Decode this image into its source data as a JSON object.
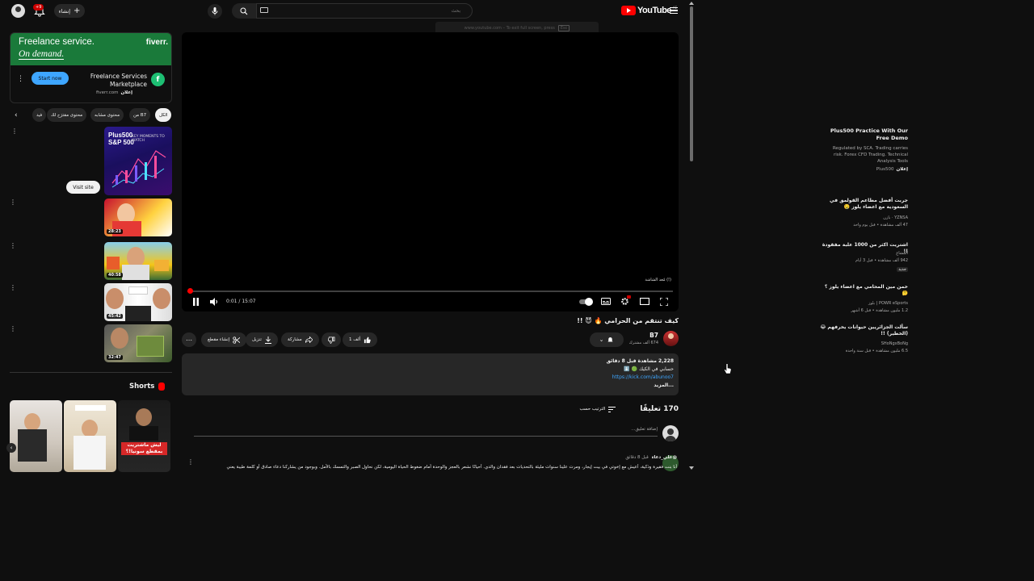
{
  "topbar": {
    "create_label": "إنشاء",
    "notif_count": "+9",
    "search_placeholder": "بحث",
    "logo_text": "YouTube",
    "country_code": "AE"
  },
  "fullscreen_hint": {
    "text": "www.youtube.com – To exit full screen, press",
    "key": "Esc"
  },
  "ad": {
    "headline1": "Freelance service.",
    "headline2": "On demand.",
    "brand": "fiverr.",
    "cta": "Start now",
    "title": "Freelance Services Marketplace",
    "sponsored": "إعلان",
    "domain": "fiverr.com",
    "logo_letter": "f"
  },
  "chips": [
    "الكل",
    "من B7",
    "محتوى مشابه",
    "محتوى مقترَح لك",
    "فيد"
  ],
  "sidebar_ad": {
    "title": "Plus500 Practice With Our Free Demo",
    "description": "Regulated by SCA. Trading carries risk. Forex CFD Trading. Technical Analysis Tools",
    "sponsored": "إعلان",
    "advertiser": "Plus500",
    "cta": "Visit site",
    "thumb_brand": "Plus500",
    "thumb_sub": "S&P 500",
    "thumb_text": "KEY MOMENTS TO WATCH"
  },
  "related": [
    {
      "title": "جربت أفضل مطاعم القولمق في السعودية مع اعضاء يلوز 🤤",
      "channel": "YZNSA · بازن",
      "meta": "47 ألف مشاهدة • قبل يوم واحد",
      "duration": "28:23"
    },
    {
      "title": "اشتريت اكثر من 1000 علبة مفقودة !!",
      "channel": "المشاغ",
      "meta": "942 ألف مشاهدة • قبل 3 أيام",
      "duration": "40:58",
      "badge": "جديد"
    },
    {
      "title": "خمن مين المحامي مع اعضاء يلوز ؟ 🤔",
      "channel": "POWR eSports | بلوز",
      "meta": "1.2 مليون مشاهدة • قبل 6 أشهر",
      "duration": "45:42"
    },
    {
      "title": "سألت الجزائريين حيوانات يخرفهم 😂 (الخطير) !!",
      "channel": "SHoNgxBoNg",
      "meta": "6.5 مليون مشاهدة • قبل سنة واحدة",
      "duration": "32:47"
    }
  ],
  "shorts": {
    "heading": "Shorts",
    "items": [
      {
        "caption": ""
      },
      {
        "caption": ""
      },
      {
        "caption": "ليش ماشتريت بمقطع سونيا!؟"
      }
    ]
  },
  "player": {
    "current_time": "0:01",
    "duration": "15:07",
    "progress": 0.001,
    "mod_badge": "مُعد الشاشة (!)"
  },
  "video": {
    "title": "كيف تنتقم من الحرامي 🔥 😈 !!",
    "channel": "B7",
    "subscribers": "674 ألف مشترك",
    "likes": "1 ألف",
    "share": "مشاركة",
    "download": "تنزيل",
    "clip": "إنشاء مقطع"
  },
  "description": {
    "stats": "2,228 مشاهدة قبل 8 دقائق",
    "line1": "حسابي في الكيك 🟢 ⬇️",
    "link": "https://kick.com/abunoo7",
    "more": "...المزيد"
  },
  "comments": {
    "count": "170 تعليقًا",
    "sort": "الترتيب حسب",
    "placeholder": "إضافة تعليق...",
    "first": {
      "author": "@علي_دعاء",
      "time": "قبل 8 دقائق",
      "text": "أنا بنت فقيرة وذكية، أعيش مع إخوتي في بيت إيجار، ومرت علينا سنوات مليئة بالتحديات بعد فقدان والدي. أحيانًا نشعر بالعجز والوحدة أمام ضغوط الحياة اليومية، لكن نحاول الصبر والتمسك بالأمل. وبوجود من يشاركنا دعاء صادق أو كلمة طيبة يعني"
    }
  }
}
